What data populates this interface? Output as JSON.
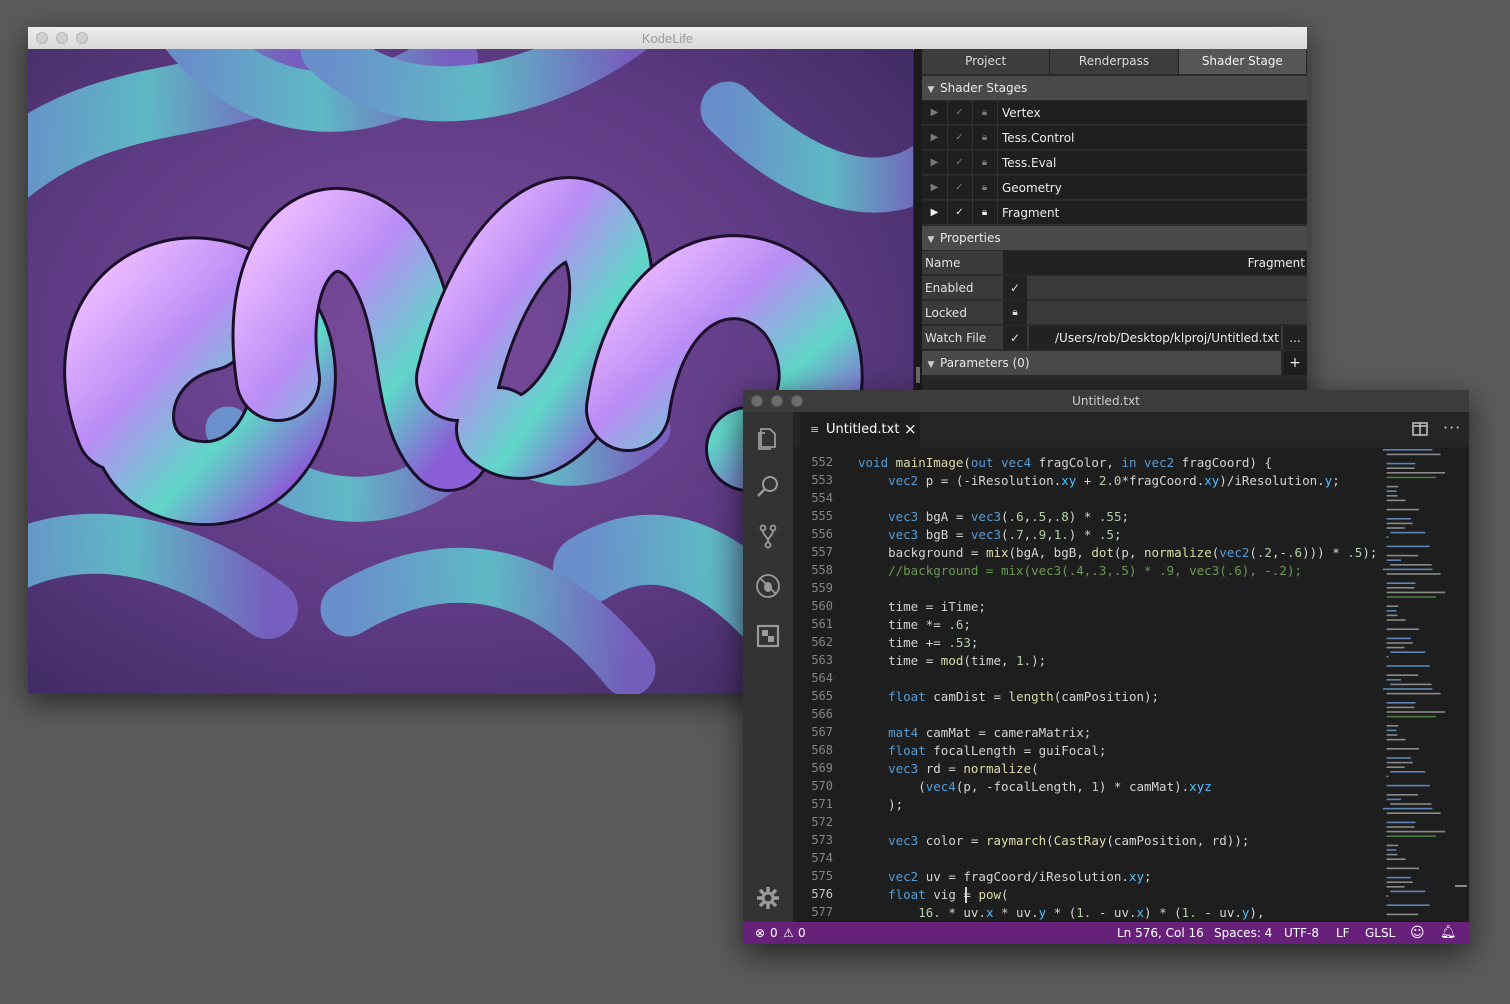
{
  "kodelife": {
    "window_title": "KodeLife",
    "tabs": [
      {
        "label": "Project",
        "active": false
      },
      {
        "label": "Renderpass",
        "active": false
      },
      {
        "label": "Shader Stage",
        "active": true
      }
    ],
    "shader_stages_header": "Shader Stages",
    "stages": [
      {
        "label": "Vertex",
        "active": false
      },
      {
        "label": "Tess.Control",
        "active": false
      },
      {
        "label": "Tess.Eval",
        "active": false
      },
      {
        "label": "Geometry",
        "active": false
      },
      {
        "label": "Fragment",
        "active": true
      }
    ],
    "properties_header": "Properties",
    "properties": {
      "name_label": "Name",
      "name_value": "Fragment",
      "enabled_label": "Enabled",
      "locked_label": "Locked",
      "watch_file_label": "Watch File",
      "watch_file_path": "/Users/rob/Desktop/klproj/Untitled.txt",
      "browse_label": "..."
    },
    "parameters_header": "Parameters (0)",
    "add_parameter_label": "+"
  },
  "vscode": {
    "window_title": "Untitled.txt",
    "tab_label": "Untitled.txt",
    "tab_close": "×",
    "line_numbers": [
      "552",
      "553",
      "554",
      "555",
      "556",
      "557",
      "558",
      "559",
      "560",
      "561",
      "562",
      "563",
      "564",
      "565",
      "566",
      "567",
      "568",
      "569",
      "570",
      "571",
      "572",
      "573",
      "574",
      "575",
      "576",
      "577"
    ],
    "current_line": "576",
    "code_lines": [
      "void mainImage(out vec4 fragColor, in vec2 fragCoord) {",
      "    vec2 p = (-iResolution.xy + 2.0*fragCoord.xy)/iResolution.y;",
      "",
      "    vec3 bgA = vec3(.6,.5,.8) * .55;",
      "    vec3 bgB = vec3(.7,.9,1.) * .5;",
      "    background = mix(bgA, bgB, dot(p, normalize(vec2(.2,-.6))) * .5);",
      "    //background = mix(vec3(.4,.3,.5) * .9, vec3(.6), -.2);",
      "",
      "    time = iTime;",
      "    time *= .6;",
      "    time += .53;",
      "    time = mod(time, 1.);",
      "",
      "    float camDist = length(camPosition);",
      "",
      "    mat4 camMat = cameraMatrix;",
      "    float focalLength = guiFocal;",
      "    vec3 rd = normalize(",
      "        (vec4(p, -focalLength, 1) * camMat).xyz",
      "    );",
      "",
      "    vec3 color = raymarch(CastRay(camPosition, rd));",
      "",
      "    vec2 uv = fragCoord/iResolution.xy;",
      "    float vig = pow(",
      "        16. * uv.x * uv.y * (1. - uv.x) * (1. - uv.y),"
    ],
    "status": {
      "errors": "0",
      "warnings": "0",
      "position": "Ln 576, Col 16",
      "spaces": "Spaces: 4",
      "encoding": "UTF-8",
      "eol": "LF",
      "language": "GLSL"
    },
    "colors": {
      "status_bar": "#68217a",
      "editor_bg": "#1e1e1e",
      "keyword": "#569cd6",
      "function": "#dcdcaa",
      "number": "#b5cea8",
      "comment": "#6a9955"
    }
  }
}
